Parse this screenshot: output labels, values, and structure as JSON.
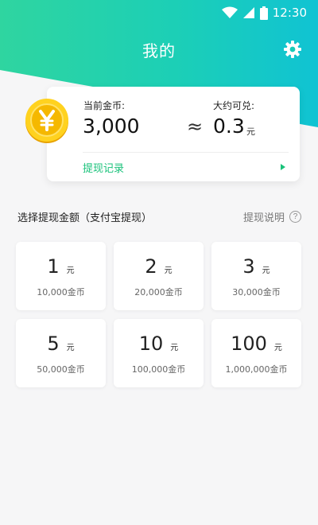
{
  "status_bar": {
    "time": "12:30"
  },
  "header": {
    "title": "我的"
  },
  "balance_card": {
    "coins_label": "当前金币:",
    "coins_value": "3,000",
    "approx_symbol": "≈",
    "exchange_label": "大约可兑:",
    "exchange_value": "0.3",
    "exchange_unit": "元",
    "record_link": "提现记录"
  },
  "section": {
    "title": "选择提现金额（支付宝提现）",
    "help_label": "提现说明",
    "help_icon_text": "?"
  },
  "options": [
    {
      "amount": "1",
      "unit": "元",
      "cost": "10,000金币"
    },
    {
      "amount": "2",
      "unit": "元",
      "cost": "20,000金币"
    },
    {
      "amount": "3",
      "unit": "元",
      "cost": "30,000金币"
    },
    {
      "amount": "5",
      "unit": "元",
      "cost": "50,000金币"
    },
    {
      "amount": "10",
      "unit": "元",
      "cost": "100,000金币"
    },
    {
      "amount": "100",
      "unit": "元",
      "cost": "1,000,000金币"
    }
  ],
  "icons": {
    "coin": "yuan-coin-icon",
    "settings": "gear-icon",
    "wifi": "wifi-icon",
    "signal": "signal-icon",
    "battery": "battery-icon",
    "arrow": "arrow-right-icon",
    "help": "help-icon"
  },
  "colors": {
    "header_gradient_start": "#2fd5a0",
    "header_gradient_end": "#10c3d3",
    "accent_green": "#19c27a",
    "coin_gold": "#f5b800"
  }
}
